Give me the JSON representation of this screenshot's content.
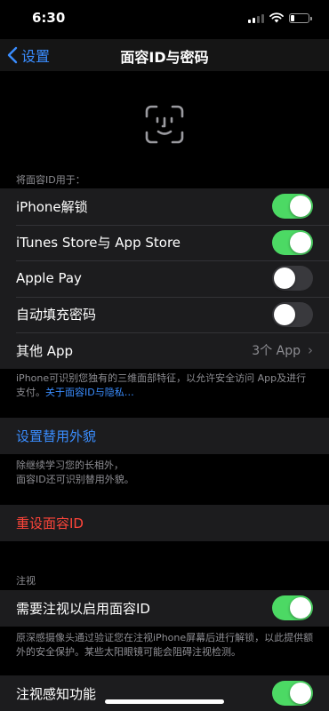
{
  "status": {
    "time": "6:30"
  },
  "nav": {
    "back_label": "设置",
    "title": "面容ID与密码"
  },
  "use_for": {
    "header": "将面容ID用于：",
    "items": [
      {
        "label": "iPhone解锁",
        "on": true
      },
      {
        "label": "iTunes Store与 App Store",
        "on": true
      },
      {
        "label": "Apple Pay",
        "on": false
      },
      {
        "label": "自动填充密码",
        "on": false
      }
    ],
    "other_apps": {
      "label": "其他 App",
      "detail": "3个 App"
    },
    "footer_text": "iPhone可识别您独有的三维面部特征，以允许安全访问 App及进行支付。",
    "footer_link": "关于面容ID与隐私…"
  },
  "alternate": {
    "label": "设置替用外貌",
    "footer": "除继续学习您的长相外，\n面容ID还可识别替用外貌。"
  },
  "reset": {
    "label": "重设面容ID"
  },
  "attention": {
    "header": "注视",
    "require_label": "需要注视以启用面容ID",
    "require_on": true,
    "require_footer": "原深感摄像头通过验证您在注视iPhone屏幕后进行解锁，以此提供额外的安全保护。某些太阳眼镜可能会阻碍注视检测。",
    "aware_label": "注视感知功能",
    "aware_on": true
  },
  "colors": {
    "accent": "#3a8dff",
    "toggle_on": "#4cd964",
    "destructive": "#ff453a",
    "cell_bg": "#1c1c1e"
  },
  "icons": [
    "chevron-left-icon",
    "face-id-icon",
    "signal-icon",
    "wifi-icon",
    "battery-icon",
    "chevron-right-icon"
  ]
}
